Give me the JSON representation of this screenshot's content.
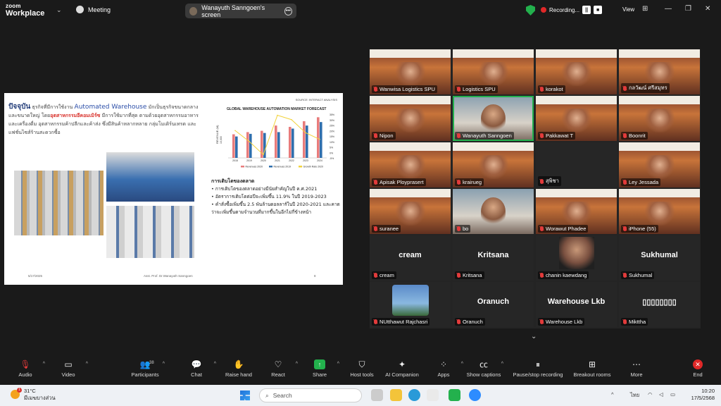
{
  "app": {
    "logo_line1": "zoom",
    "logo_line2": "Workplace",
    "meeting_label": "Meeting",
    "share_title": "Wanayuth Sanngoen's screen",
    "recording": "Recording...",
    "view": "View"
  },
  "slide": {
    "source": "SOURCE: INTERACT ANALYSIS",
    "intro_big": "ปัจจุบัน",
    "intro_a": " ธุรกิจที่มีการใช้งาน ",
    "intro_aw": "Automated Warehouse",
    "intro_b": " มักเป็นธุรกิจขนาดกลางและขนาดใหญ่ โดย",
    "intro_red": "อุตสาหกรรมอีคอมเมิร์ซ",
    "intro_c": " มีการใช้มากที่สุด ตามด้วยอุตสาหกรรมอาหารและเครื่องดื่ม อุตสาหกรรมค้าปลีกและค้าส่ง ซึ่งมีสินค้าหลากหลาย กลุ่มโมเดิร์นเทรด และแฟชั่นไซส์ร้านสะดวกซื้อ",
    "bullets_heading": "การเติบโตของตลาด",
    "bullets": [
      "• การเติบโตของตลาดอย่างมีนัยสำคัญในปี ค.ศ.2021",
      "• อัตราการเติบโตต่อปีจะเพิ่มขึ้น 11.9% ในปี 2019-2023",
      "• คำสั่งซื้อเพิ่มขึ้น 2.5 พันล้านดอลลาร์ในปี 2020-2021 และคาดว่าจะเพิ่มขึ้นตามจำนวนที่มากขึ้นในอีกไม่กี่ข้างหน้า"
    ],
    "footer_date": "5/17/2025",
    "footer_author": "Asst. Prof. Dr.Wanayuth Sanngoen",
    "footer_page": "8"
  },
  "chart_data": {
    "type": "bar",
    "title": "GLOBAL WAREHOUSE AUTOMATION MARKET FORECAST",
    "ylabel": "REVENUE (M)",
    "y_tick_left": "10,000",
    "categories": [
      "2018",
      "2019",
      "2020",
      "2021",
      "2022",
      "2023",
      "2024"
    ],
    "series": [
      {
        "name": "Revenues 2020",
        "values": [
          5400,
          5900,
          6200,
          7400,
          7100,
          8400,
          9300
        ]
      },
      {
        "name": "Revenues 2019",
        "values": [
          4900,
          5500,
          5700,
          5900,
          6700,
          7400,
          8200
        ]
      },
      {
        "name": "Growth Rate 2020",
        "values": [
          20,
          10,
          -2,
          34,
          30,
          18,
          12
        ]
      }
    ],
    "y2_ticks": [
      "35%",
      "30%",
      "25%",
      "20%",
      "15%",
      "10%",
      "5%",
      "0%",
      "-5%"
    ],
    "ylim": [
      0,
      10000
    ],
    "y2lim": [
      -5,
      35
    ],
    "colors": [
      "#e87c7c",
      "#2f6fae",
      "#f2d33b"
    ],
    "legend": "bottom"
  },
  "gallery": {
    "tiles": [
      {
        "name": "Wanwisa Logistics SPU",
        "kind": "vid"
      },
      {
        "name": "Logistics SPU",
        "kind": "vid"
      },
      {
        "name": "korakot",
        "kind": "vid"
      },
      {
        "name": "กลวัฒน์ ศรีสมุทร",
        "kind": "vid"
      },
      {
        "name": "Nipon",
        "kind": "vid"
      },
      {
        "name": "Wanayuth Sanngoen",
        "kind": "cam"
      },
      {
        "name": "Pakkawat T",
        "kind": "vid"
      },
      {
        "name": "Boonrit",
        "kind": "vid"
      },
      {
        "name": "Apisak Ployprasert",
        "kind": "vid"
      },
      {
        "name": "krairueg",
        "kind": "vid"
      },
      {
        "name": "สุพิชา",
        "kind": "dark"
      },
      {
        "name": "Ley Jessada",
        "kind": "vid"
      },
      {
        "name": "suranee",
        "kind": "vid"
      },
      {
        "name": "bo",
        "kind": "cam"
      },
      {
        "name": "Worawut Phadee",
        "kind": "vid"
      },
      {
        "name": "iPhone (55)",
        "kind": "vid"
      },
      {
        "name": "cream",
        "big": "cream",
        "kind": "blank"
      },
      {
        "name": "Kritsana",
        "big": "Kritsana",
        "kind": "blank"
      },
      {
        "name": "chanin kaewdang",
        "kind": "face"
      },
      {
        "name": "Sukhumal",
        "big": "Sukhumal",
        "kind": "blank"
      },
      {
        "name": "NUtthawut Rajchasri",
        "kind": "avatar"
      },
      {
        "name": "Oranuch",
        "big": "Oranuch",
        "kind": "blank"
      },
      {
        "name": "Warehouse Lkb",
        "big": "Warehouse Lkb",
        "kind": "blank"
      },
      {
        "name": "Mikttha",
        "big": "▯▯▯▯▯▯▯▯",
        "kind": "blank"
      }
    ]
  },
  "toolbar": {
    "audio": "Audio",
    "video": "Video",
    "participants": "Participants",
    "participants_count": "38",
    "chat": "Chat",
    "raise_hand": "Raise hand",
    "react": "React",
    "share": "Share",
    "host_tools": "Host tools",
    "ai_companion": "AI Companion",
    "apps": "Apps",
    "show_captions": "Show captions",
    "pause_recording": "Pause/stop recording",
    "breakout_rooms": "Breakout rooms",
    "more": "More",
    "end": "End"
  },
  "taskbar": {
    "temp": "31°C",
    "weather": "มีเมฆบางส่วน",
    "search": "Search",
    "lang": "ไทย",
    "time": "10:20",
    "date": "17/5/2568"
  }
}
